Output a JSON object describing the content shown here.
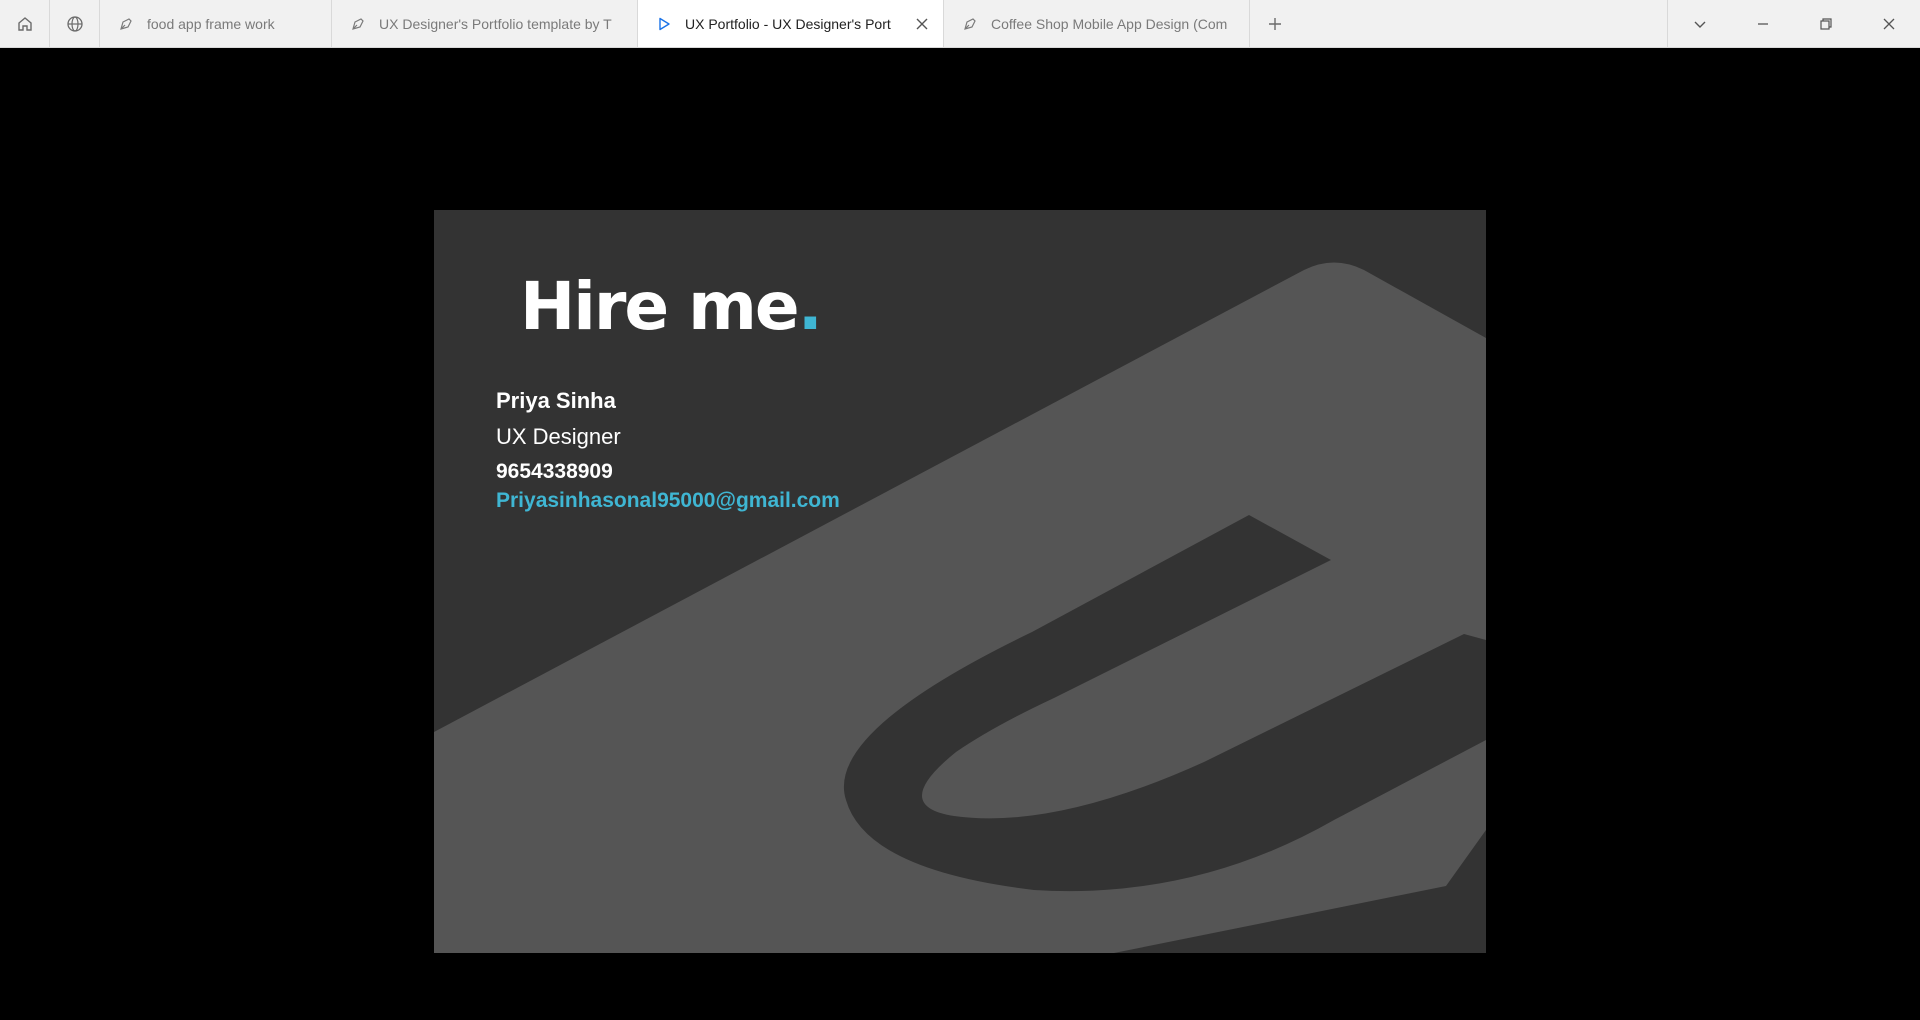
{
  "tabbar": {
    "home_icon": "home-icon",
    "globe_icon": "globe-icon",
    "tabs": [
      {
        "label": "food app frame work",
        "icon": "figma-pen-icon"
      },
      {
        "label": "UX Designer's Portfolio template by T",
        "icon": "figma-pen-icon"
      },
      {
        "label": "UX Portfolio - UX Designer's Port",
        "icon": "play-icon",
        "active": true
      },
      {
        "label": "Coffee Shop Mobile App Design (Com",
        "icon": "figma-pen-icon"
      }
    ],
    "new_tab": "+",
    "window_controls": [
      "chevron-down-icon",
      "minimize-icon",
      "restore-icon",
      "close-icon"
    ]
  },
  "slide": {
    "title": "Hire me",
    "title_dot": ".",
    "name": "Priya Sinha",
    "role": "UX Designer",
    "phone": "9654338909",
    "email": "Priyasinhasonal95000@gmail.com"
  },
  "colors": {
    "accent": "#3fb6d3",
    "slide_bg": "#333333",
    "shape": "#555555",
    "tabbar_bg": "#f1f1f1"
  }
}
